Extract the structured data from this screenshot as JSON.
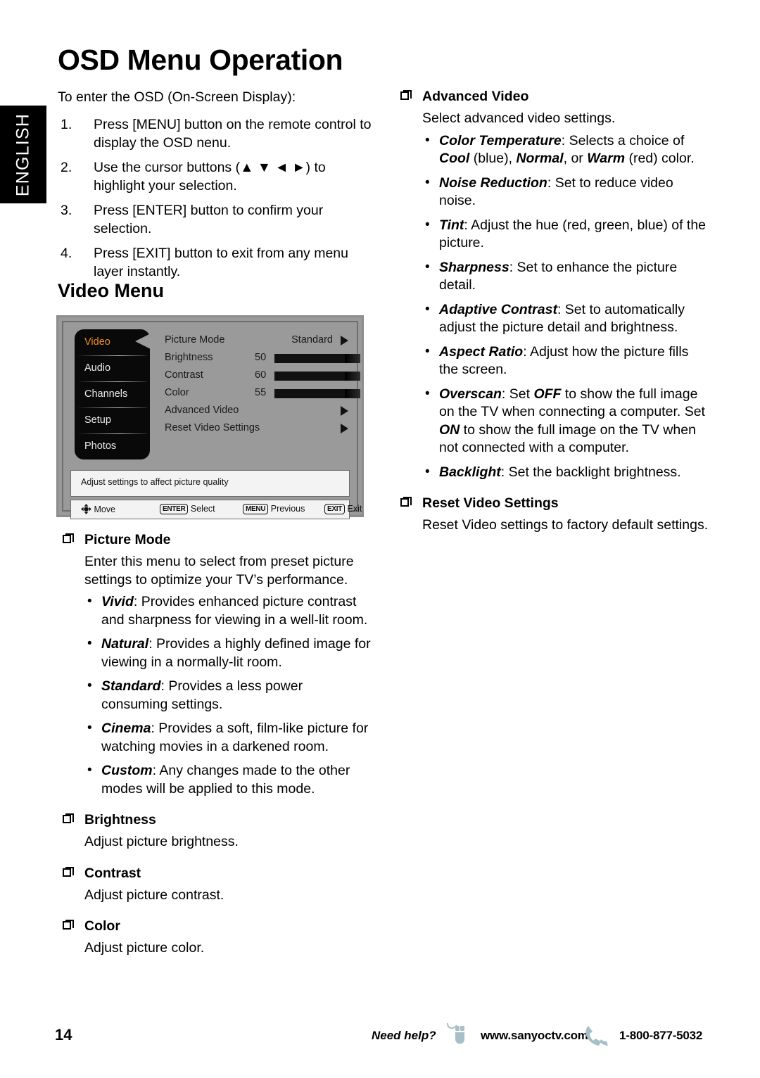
{
  "side_tab": {
    "label": "ENGLISH"
  },
  "page_title": "OSD Menu Operation",
  "intro": "To enter the OSD (On-Screen Display):",
  "steps": [
    {
      "num": "1.",
      "text": "Press [MENU] button on the remote control to display the OSD nenu."
    },
    {
      "num": "2.",
      "text": "Use the cursor buttons (▲ ▼ ◄ ►) to highlight your selection."
    },
    {
      "num": "3.",
      "text": "Press [ENTER] button to confirm your selection."
    },
    {
      "num": "4.",
      "text": "Press [EXIT] button to exit from any menu layer instantly."
    }
  ],
  "video_menu_heading": "Video Menu",
  "osd": {
    "sidebar": [
      {
        "label": "Video",
        "selected": true
      },
      {
        "label": "Audio",
        "selected": false
      },
      {
        "label": "Channels",
        "selected": false
      },
      {
        "label": "Setup",
        "selected": false
      },
      {
        "label": "Photos",
        "selected": false
      }
    ],
    "rows": [
      {
        "label": "Picture Mode",
        "value": "Standard",
        "arrow": true
      },
      {
        "label": "Brightness",
        "number": "50",
        "bar": 50
      },
      {
        "label": "Contrast",
        "number": "60",
        "bar": 60
      },
      {
        "label": "Color",
        "number": "55",
        "bar": 55
      },
      {
        "label": "Advanced Video",
        "arrow": true
      },
      {
        "label": "Reset Video Settings",
        "arrow": true
      }
    ],
    "hint": "Adjust settings to affect picture quality",
    "keys": [
      {
        "cap": "dpad",
        "label": "Move"
      },
      {
        "cap": "ENTER",
        "label": "Select"
      },
      {
        "cap": "MENU",
        "label": "Previous"
      },
      {
        "cap": "EXIT",
        "label": "Exit"
      }
    ],
    "colors": {
      "panel": "#9a9a9a",
      "sidebar": "#090909",
      "selected_text": "#f08c22",
      "strip": "#f3f3f3"
    }
  },
  "left_sections": [
    {
      "title": "Picture Mode",
      "body": "Enter this menu to select from preset picture settings to optimize your TV’s performance.",
      "bullets": [
        {
          "term": "Vivid",
          "rest": ": Provides enhanced picture contrast and sharpness for viewing in a well-lit room."
        },
        {
          "term": "Natural",
          "rest": ": Provides a highly defined image for viewing in a normally-lit room."
        },
        {
          "term": "Standard",
          "rest": ": Provides a less power consuming settings."
        },
        {
          "term": "Cinema",
          "rest": ": Provides a soft, film-like picture for watching movies in a darkened room."
        },
        {
          "term": "Custom",
          "rest": ": Any changes made to the other modes will be applied to this mode."
        }
      ]
    },
    {
      "title": "Brightness",
      "body": "Adjust picture brightness.",
      "bullets": []
    },
    {
      "title": "Contrast",
      "body": "Adjust picture contrast.",
      "bullets": []
    },
    {
      "title": "Color",
      "body": "Adjust picture color.",
      "bullets": []
    }
  ],
  "right_sections": [
    {
      "title": "Advanced Video",
      "body": "Select advanced video settings.",
      "bullets": [
        {
          "term": "Color Temperature",
          "rest": ": Selects a choice of Cool (blue), Normal, or Warm (red) color."
        },
        {
          "term": "Noise Reduction",
          "rest": ": Set to reduce video noise."
        },
        {
          "term": "Tint",
          "rest": ": Adjust the hue (red, green, blue) of the picture."
        },
        {
          "term": "Sharpness",
          "rest": ": Set to enhance the picture detail."
        },
        {
          "term": "Adaptive Contrast",
          "rest": ": Set to automatically adjust the picture detail and brightness."
        },
        {
          "term": "Aspect Ratio",
          "rest": ": Adjust how the picture fills the screen."
        },
        {
          "term": "Overscan",
          "rest": ": Set OFF to show the full image on the TV when connecting a computer. Set ON to show the full image on the TV when not connected with a computer."
        },
        {
          "term": "Backlight",
          "rest": ": Set the backlight brightness."
        }
      ]
    },
    {
      "title": "Reset Video Settings",
      "body": "Reset Video settings to factory default settings.",
      "bullets": []
    }
  ],
  "footer": {
    "page_number": "14",
    "need_help": "Need help?",
    "url": "www.sanyoctv.com",
    "phone": "1-800-877-5032",
    "icon_color": "#a7bfc6"
  }
}
